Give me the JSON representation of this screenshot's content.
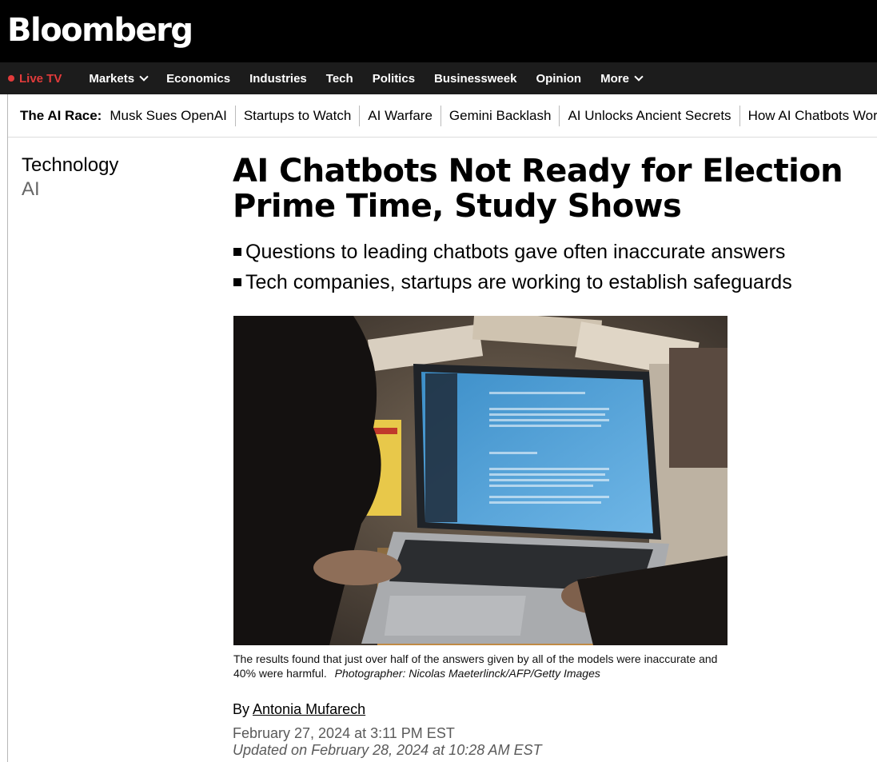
{
  "header": {
    "logo": "Bloomberg"
  },
  "nav": {
    "live": "Live TV",
    "items": [
      {
        "label": "Markets",
        "dropdown": true
      },
      {
        "label": "Economics"
      },
      {
        "label": "Industries"
      },
      {
        "label": "Tech"
      },
      {
        "label": "Politics"
      },
      {
        "label": "Businessweek"
      },
      {
        "label": "Opinion"
      },
      {
        "label": "More",
        "dropdown": true
      }
    ]
  },
  "subnav": {
    "title": "The AI Race:",
    "links": [
      "Musk Sues OpenAI",
      "Startups to Watch",
      "AI Warfare",
      "Gemini Backlash",
      "AI Unlocks Ancient Secrets",
      "How AI Chatbots Work"
    ]
  },
  "section": {
    "primary": "Technology",
    "secondary": "AI"
  },
  "article": {
    "headline": "AI Chatbots Not Ready for Election Prime Time, Study Shows",
    "bullets": [
      "Questions to leading chatbots gave often inaccurate answers",
      "Tech companies, startups are working to establish safeguards"
    ],
    "caption": "The results found that just over half of the answers given by all of the models were inaccurate and 40% were harmful.",
    "credit": "Photographer: Nicolas Maeterlinck/AFP/Getty Images",
    "by_prefix": "By",
    "author": "Antonia Mufarech",
    "published": "February 27, 2024 at 3:11 PM EST",
    "updated": "Updated on February 28, 2024 at 10:28 AM EST"
  },
  "colors": {
    "live_red": "#e23b3b",
    "navbar": "#1c1c1c",
    "topbar": "#000000",
    "date_gray": "#5a5a5a"
  }
}
